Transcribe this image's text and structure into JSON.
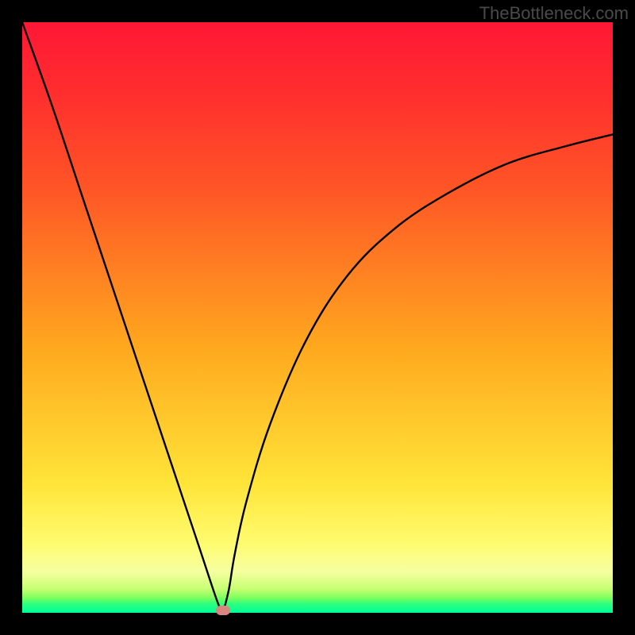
{
  "watermark": "TheBottleneck.com",
  "chart_data": {
    "type": "line",
    "title": "",
    "xlabel": "",
    "ylabel": "",
    "xlim": [
      0,
      100
    ],
    "ylim": [
      0,
      100
    ],
    "grid": false,
    "series": [
      {
        "name": "bottleneck-curve",
        "x": [
          0,
          5,
          10,
          15,
          20,
          25,
          30,
          33,
          34,
          35,
          36,
          38,
          42,
          48,
          55,
          63,
          72,
          82,
          92,
          100
        ],
        "values": [
          100,
          86,
          71,
          56,
          41,
          26,
          11,
          2,
          0,
          4,
          10,
          19,
          32,
          46,
          57,
          65,
          71,
          76,
          79,
          81
        ]
      }
    ],
    "annotations": [
      {
        "name": "min-marker",
        "x": 34,
        "y": 0,
        "color": "#d9847e"
      }
    ],
    "background_gradient": {
      "top": "#ff1735",
      "mid": "#ffe438",
      "bottom": "#00ff99"
    }
  }
}
